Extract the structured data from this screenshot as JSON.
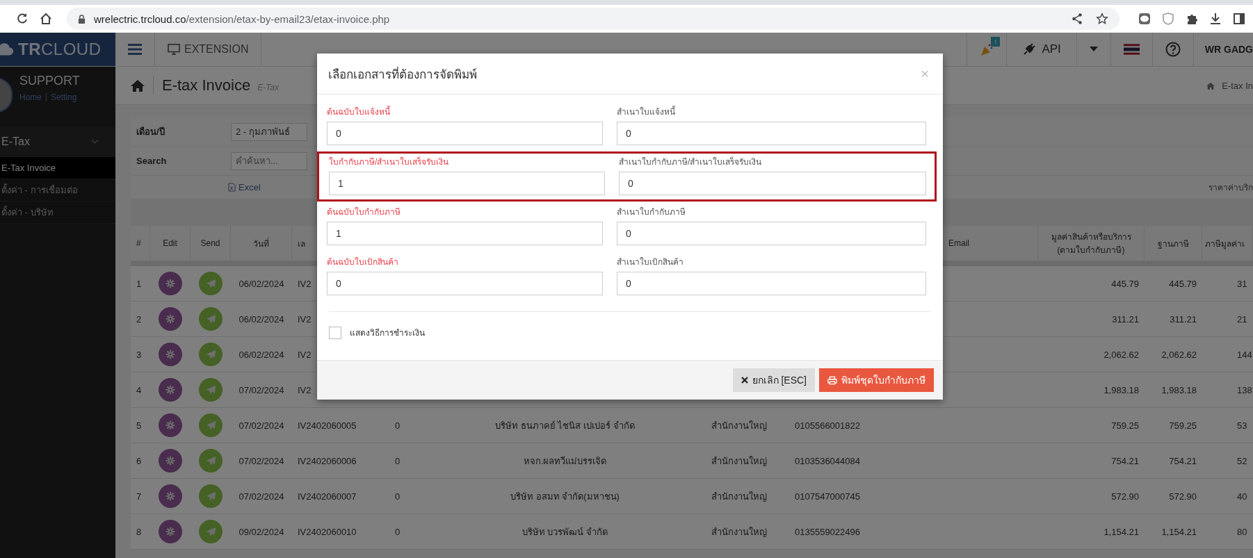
{
  "browser": {
    "url_domain": "wrelectric.trcloud.co",
    "url_path": "/extension/etax-by-email23/etax-invoice.php"
  },
  "topnav": {
    "logo_bold": "TR",
    "logo_light": "CLOUD",
    "extension": "EXTENSION",
    "notification_badge": "!",
    "api": "API",
    "user": "WR GADG"
  },
  "sidebar": {
    "profile_name": "SUPPORT",
    "links": [
      "Home",
      "Setting"
    ],
    "groups": [
      {
        "label": "E-Tax",
        "expanded": true,
        "children": [
          {
            "label": "E-Tax Invoice",
            "selected": true
          },
          {
            "label": "ตั้งค่า - การเชื่อมต่อ",
            "selected": false
          },
          {
            "label": "ตั้งค่า - บริษัท",
            "selected": false
          }
        ]
      }
    ]
  },
  "page": {
    "title": "E-tax Invoice",
    "subtitle": "E-Tax",
    "breadcrumb": "E-tax In"
  },
  "filters": {
    "month_label": "เดือน/ปี",
    "month_value": "2 - กุมภาพันธ์",
    "search_label": "Search",
    "search_placeholder": "คำค้นหา...",
    "export_link": "Excel",
    "price_label": "ราคาค่าบริก"
  },
  "table": {
    "columns": [
      {
        "label": "#"
      },
      {
        "label": "Edit"
      },
      {
        "label": "Send"
      },
      {
        "label": "วันที่"
      },
      {
        "label": "เล"
      },
      {},
      {},
      {},
      {},
      {
        "label": "Email"
      },
      {
        "label": "มูลค่าสินค้าหรือบริการ (ตามใบกำกับภาษี)"
      },
      {
        "label": "ฐานภาษี"
      },
      {
        "label": "ภาษีมูลค่าเ"
      }
    ],
    "rows": [
      {
        "no": "1",
        "date": "06/02/2024",
        "invoice": "IV2",
        "value": "445.79",
        "base": "445.79",
        "vat": "31"
      },
      {
        "no": "2",
        "date": "06/02/2024",
        "invoice": "IV2",
        "value": "311.21",
        "base": "311.21",
        "vat": "21"
      },
      {
        "no": "3",
        "date": "06/02/2024",
        "invoice": "IV2",
        "value": "2,062.62",
        "base": "2,062.62",
        "vat": "144"
      },
      {
        "no": "4",
        "date": "07/02/2024",
        "invoice": "IV2",
        "value": "1,983.18",
        "base": "1,983.18",
        "vat": "138"
      },
      {
        "no": "5",
        "date": "07/02/2024",
        "invoice": "IV2402060005",
        "code": "0",
        "company": "บริษัท ธนภาคย์ ไชนิส เปเปอร์ จำกัด",
        "branch": "สำนักงานใหญ่",
        "tax_id": "0105566001822",
        "value": "759.25",
        "base": "759.25",
        "vat": "53"
      },
      {
        "no": "6",
        "date": "07/02/2024",
        "invoice": "IV2402060006",
        "code": "0",
        "company": "หจก.ผลทวีแม่บรรเจิด",
        "branch": "สำนักงานใหญ่",
        "tax_id": "0103536044084",
        "value": "754.21",
        "base": "754.21",
        "vat": "52"
      },
      {
        "no": "7",
        "date": "07/02/2024",
        "invoice": "IV2402060007",
        "code": "0",
        "company": "บริษัท อสมท จำกัด(มหาชน)",
        "branch": "สำนักงานใหญ่",
        "tax_id": "0107547000745",
        "value": "572.90",
        "base": "572.90",
        "vat": "40"
      },
      {
        "no": "8",
        "date": "09/02/2024",
        "invoice": "IV2402060010",
        "code": "0",
        "company": "บริษัท บวรพัฒน์ จำกัด",
        "branch": "สำนักงานใหญ่",
        "tax_id": "0135559022496",
        "value": "1,154.21",
        "base": "1,154.21",
        "vat": "80"
      }
    ]
  },
  "modal": {
    "title": "เลือกเอกสารที่ต้องการจัดพิมพ์",
    "close": "×",
    "rows": [
      {
        "highlighted": false,
        "fields": [
          {
            "kind": "original",
            "label": "ต้นฉบับใบแจ้งหนี้",
            "value": "0"
          },
          {
            "kind": "copy",
            "label": "สำเนาใบแจ้งหนี้",
            "value": "0"
          }
        ]
      },
      {
        "highlighted": true,
        "fields": [
          {
            "kind": "original",
            "label": "ใบกำกับภาษี/สำเนาใบเสร็จรับเงิน",
            "value": "1"
          },
          {
            "kind": "copy",
            "label": "สำเนาใบกำกับภาษี/สำเนาใบเสร็จรับเงิน",
            "value": "0"
          }
        ]
      },
      {
        "highlighted": false,
        "fields": [
          {
            "kind": "original",
            "label": "ต้นฉบับใบกำกับภาษี",
            "value": "1"
          },
          {
            "kind": "copy",
            "label": "สำเนาใบกำกับภาษี",
            "value": "0"
          }
        ]
      },
      {
        "highlighted": false,
        "fields": [
          {
            "kind": "original",
            "label": "ต้นฉบับใบเบิกสินค้า",
            "value": "0"
          },
          {
            "kind": "copy",
            "label": "สำเนาใบเบิกสินค้า",
            "value": "0"
          }
        ]
      }
    ],
    "payment_option": {
      "label": "แสดงวิธีการชำระเงิน",
      "checked": false
    },
    "cancel_button": "ยกเลิก [ESC]",
    "print_button": "พิมพ์ชุดใบกำกับภาษี"
  }
}
